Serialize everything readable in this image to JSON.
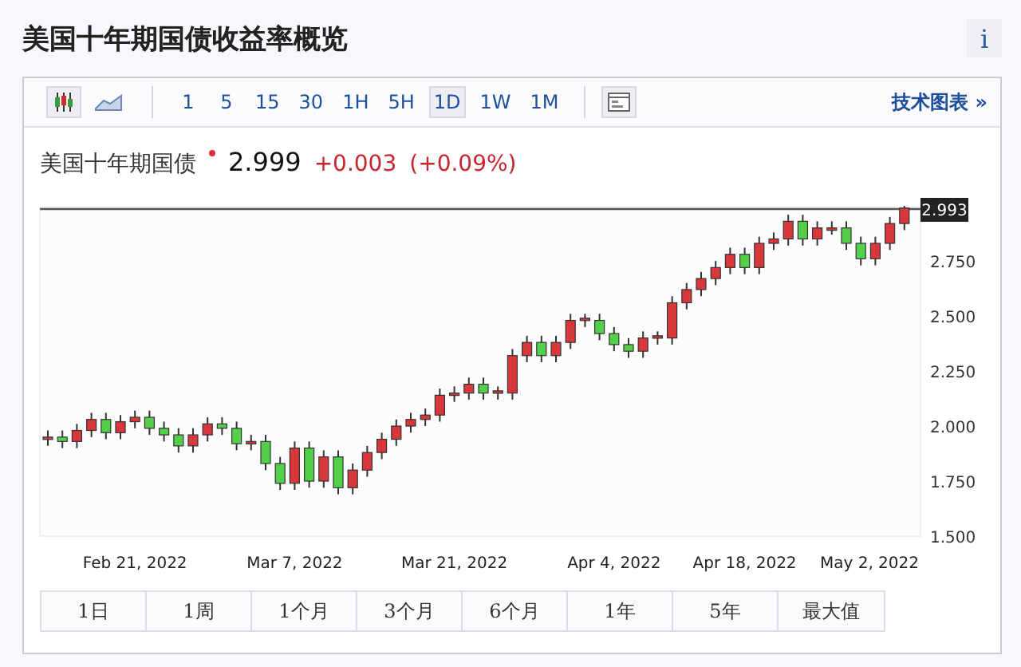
{
  "page_title": "美国十年期国债收益率概览",
  "info_button": "i",
  "toolbar": {
    "chart_types": [
      {
        "kind": "candles",
        "selected": true
      },
      {
        "kind": "area",
        "selected": false
      }
    ],
    "intervals": [
      {
        "label": "1",
        "selected": false
      },
      {
        "label": "5",
        "selected": false
      },
      {
        "label": "15",
        "selected": false
      },
      {
        "label": "30",
        "selected": false
      },
      {
        "label": "1H",
        "selected": false
      },
      {
        "label": "5H",
        "selected": false
      },
      {
        "label": "1D",
        "selected": true
      },
      {
        "label": "1W",
        "selected": false
      },
      {
        "label": "1M",
        "selected": false
      }
    ],
    "tech_chart_link": "技术图表 »"
  },
  "quote": {
    "name": "美国十年期国债",
    "price": "2.999",
    "change": "+0.003",
    "change_percent": "(+0.09%)"
  },
  "chart": {
    "last_price_tag": "2.993",
    "chart_data": {
      "type": "candlestick",
      "categories": [
        null,
        null,
        null,
        null,
        null,
        null,
        "Feb 21, 2022",
        null,
        null,
        null,
        null,
        null,
        null,
        null,
        null,
        null,
        null,
        "Mar 7, 2022",
        null,
        null,
        null,
        null,
        null,
        null,
        null,
        null,
        null,
        null,
        "Mar 21, 2022",
        null,
        null,
        null,
        null,
        null,
        null,
        null,
        null,
        null,
        null,
        "Apr 4, 2022",
        null,
        null,
        null,
        null,
        null,
        null,
        null,
        null,
        "Apr 18, 2022",
        null,
        null,
        null,
        null,
        null,
        null,
        null,
        null,
        "May 2, 2022",
        null,
        null
      ],
      "ohlc": [
        [
          1.94,
          1.98,
          1.91,
          1.95
        ],
        [
          1.95,
          1.98,
          1.9,
          1.93
        ],
        [
          1.93,
          2.01,
          1.9,
          1.98
        ],
        [
          1.98,
          2.06,
          1.95,
          2.03
        ],
        [
          2.03,
          2.06,
          1.94,
          1.97
        ],
        [
          1.97,
          2.05,
          1.94,
          2.02
        ],
        [
          2.02,
          2.07,
          1.99,
          2.04
        ],
        [
          2.04,
          2.07,
          1.96,
          1.99
        ],
        [
          1.99,
          2.02,
          1.93,
          1.96
        ],
        [
          1.96,
          1.99,
          1.88,
          1.91
        ],
        [
          1.91,
          1.99,
          1.88,
          1.96
        ],
        [
          1.96,
          2.04,
          1.93,
          2.01
        ],
        [
          2.01,
          2.04,
          1.96,
          1.99
        ],
        [
          1.99,
          2.02,
          1.89,
          1.92
        ],
        [
          1.92,
          1.96,
          1.89,
          1.93
        ],
        [
          1.93,
          1.96,
          1.8,
          1.83
        ],
        [
          1.83,
          1.86,
          1.71,
          1.74
        ],
        [
          1.74,
          1.93,
          1.71,
          1.9
        ],
        [
          1.9,
          1.93,
          1.72,
          1.75
        ],
        [
          1.75,
          1.89,
          1.72,
          1.86
        ],
        [
          1.86,
          1.89,
          1.69,
          1.72
        ],
        [
          1.72,
          1.83,
          1.69,
          1.8
        ],
        [
          1.8,
          1.91,
          1.77,
          1.88
        ],
        [
          1.88,
          1.97,
          1.85,
          1.94
        ],
        [
          1.94,
          2.03,
          1.91,
          2.0
        ],
        [
          2.0,
          2.06,
          1.97,
          2.03
        ],
        [
          2.03,
          2.08,
          2.0,
          2.05
        ],
        [
          2.05,
          2.17,
          2.02,
          2.14
        ],
        [
          2.14,
          2.18,
          2.11,
          2.15
        ],
        [
          2.15,
          2.22,
          2.12,
          2.19
        ],
        [
          2.19,
          2.22,
          2.12,
          2.15
        ],
        [
          2.15,
          2.18,
          2.12,
          2.16
        ],
        [
          2.15,
          2.35,
          2.12,
          2.32
        ],
        [
          2.32,
          2.41,
          2.29,
          2.38
        ],
        [
          2.38,
          2.41,
          2.29,
          2.32
        ],
        [
          2.32,
          2.41,
          2.29,
          2.38
        ],
        [
          2.38,
          2.51,
          2.35,
          2.48
        ],
        [
          2.48,
          2.51,
          2.45,
          2.49
        ],
        [
          2.48,
          2.51,
          2.39,
          2.42
        ],
        [
          2.42,
          2.45,
          2.34,
          2.37
        ],
        [
          2.37,
          2.4,
          2.31,
          2.34
        ],
        [
          2.34,
          2.43,
          2.31,
          2.4
        ],
        [
          2.4,
          2.43,
          2.37,
          2.41
        ],
        [
          2.4,
          2.59,
          2.37,
          2.56
        ],
        [
          2.56,
          2.65,
          2.53,
          2.62
        ],
        [
          2.62,
          2.7,
          2.59,
          2.67
        ],
        [
          2.67,
          2.75,
          2.64,
          2.72
        ],
        [
          2.72,
          2.81,
          2.69,
          2.78
        ],
        [
          2.78,
          2.81,
          2.69,
          2.72
        ],
        [
          2.72,
          2.86,
          2.69,
          2.83
        ],
        [
          2.83,
          2.88,
          2.8,
          2.85
        ],
        [
          2.85,
          2.96,
          2.82,
          2.93
        ],
        [
          2.93,
          2.96,
          2.82,
          2.85
        ],
        [
          2.85,
          2.93,
          2.82,
          2.9
        ],
        [
          2.9,
          2.93,
          2.87,
          2.9
        ],
        [
          2.9,
          2.93,
          2.8,
          2.83
        ],
        [
          2.83,
          2.86,
          2.73,
          2.76
        ],
        [
          2.76,
          2.86,
          2.73,
          2.83
        ],
        [
          2.83,
          2.95,
          2.8,
          2.92
        ],
        [
          2.92,
          3.0,
          2.89,
          2.99
        ]
      ],
      "ylim": [
        1.5,
        2.993
      ],
      "yticks": [
        {
          "value": 2.75,
          "label": "2.750"
        },
        {
          "value": 2.5,
          "label": "2.500"
        },
        {
          "value": 2.25,
          "label": "2.250"
        },
        {
          "value": 2.0,
          "label": "2.000"
        },
        {
          "value": 1.75,
          "label": "1.750"
        },
        {
          "value": 1.5,
          "label": "1.500"
        }
      ]
    }
  },
  "ranges": [
    {
      "label": "1日"
    },
    {
      "label": "1周"
    },
    {
      "label": "1个月"
    },
    {
      "label": "3个月"
    },
    {
      "label": "6个月"
    },
    {
      "label": "1年"
    },
    {
      "label": "5年"
    },
    {
      "label": "最大值"
    }
  ]
}
